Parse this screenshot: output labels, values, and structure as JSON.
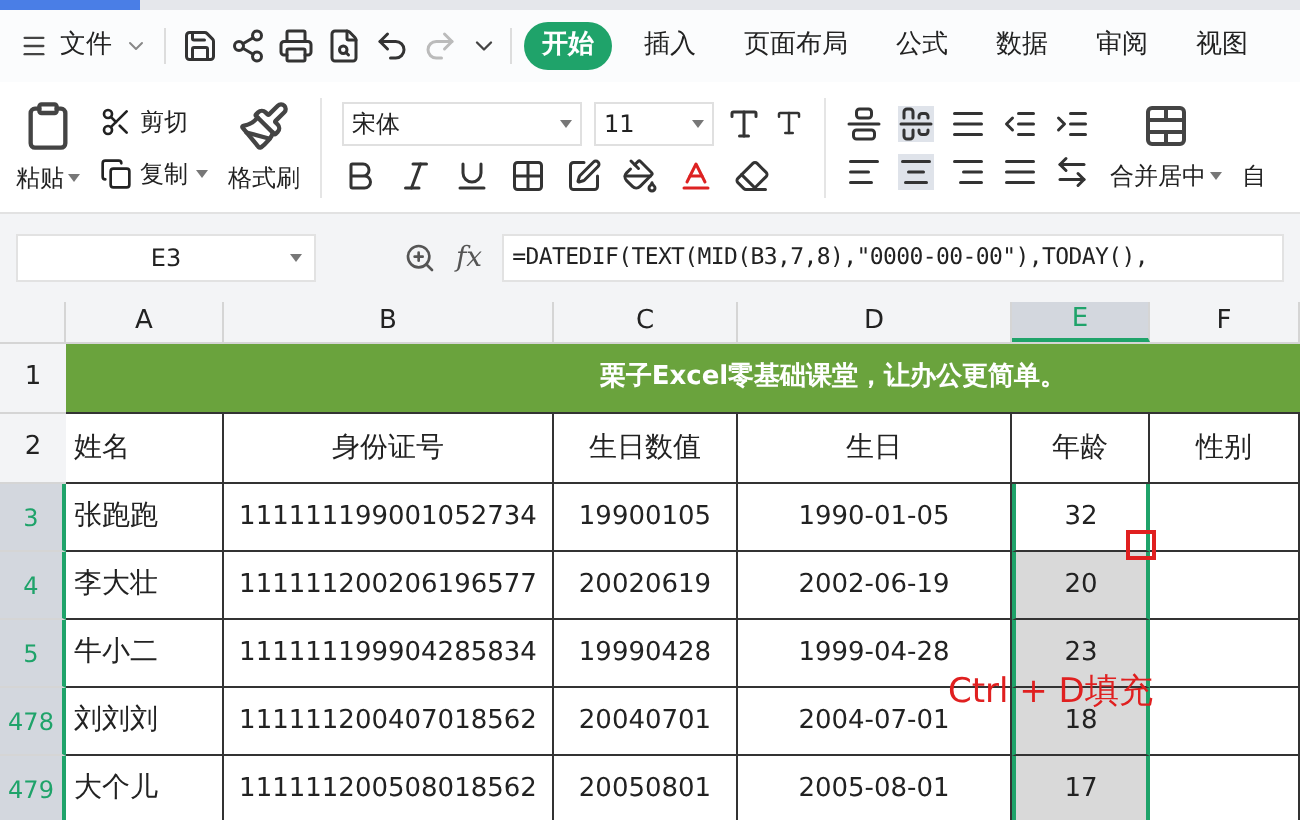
{
  "menu": {
    "file": "文件",
    "tabs": [
      {
        "label": "开始",
        "selected": true
      },
      {
        "label": "插入",
        "selected": false
      },
      {
        "label": "页面布局",
        "selected": false
      },
      {
        "label": "公式",
        "selected": false
      },
      {
        "label": "数据",
        "selected": false
      },
      {
        "label": "审阅",
        "selected": false
      },
      {
        "label": "视图",
        "selected": false
      }
    ]
  },
  "ribbon": {
    "paste": "粘贴",
    "cut": "剪切",
    "copy": "复制",
    "format_painter": "格式刷",
    "font": "宋体",
    "font_size": "11",
    "merge": "合并居中",
    "cut_off_label": "自"
  },
  "formula_bar": {
    "cell_ref": "E3",
    "fx": "fx",
    "formula": "=DATEDIF(TEXT(MID(B3,7,8),\"0000-00-00\"),TODAY(),"
  },
  "columns": [
    {
      "label": "A",
      "selected": false
    },
    {
      "label": "B",
      "selected": false
    },
    {
      "label": "C",
      "selected": false
    },
    {
      "label": "D",
      "selected": false
    },
    {
      "label": "E",
      "selected": true
    },
    {
      "label": "F",
      "selected": false
    }
  ],
  "title_row": {
    "number": "1",
    "text": "栗子Excel零基础课堂，让办公更简单。"
  },
  "header_row": {
    "number": "2",
    "cells": [
      "姓名",
      "身份证号",
      "生日数值",
      "生日",
      "年龄",
      "性别"
    ]
  },
  "rows": [
    {
      "number": "3",
      "selected": true,
      "active": true,
      "cells": [
        "张跑跑",
        "111111199001052734",
        "19900105",
        "1990-01-05",
        "32"
      ]
    },
    {
      "number": "4",
      "selected": true,
      "active": false,
      "cells": [
        "李大壮",
        "111111200206196577",
        "20020619",
        "2002-06-19",
        "20"
      ]
    },
    {
      "number": "5",
      "selected": true,
      "active": false,
      "cells": [
        "牛小二",
        "111111199904285834",
        "19990428",
        "1999-04-28",
        "23"
      ]
    },
    {
      "number": "478",
      "selected": true,
      "active": false,
      "cells": [
        "刘刘刘",
        "111111200407018562",
        "20040701",
        "2004-07-01",
        "18"
      ]
    },
    {
      "number": "479",
      "selected": true,
      "active": false,
      "cells": [
        "大个儿",
        "111111200508018562",
        "20050801",
        "2005-08-01",
        "17"
      ]
    }
  ],
  "annotation": "Ctrl + D填充"
}
